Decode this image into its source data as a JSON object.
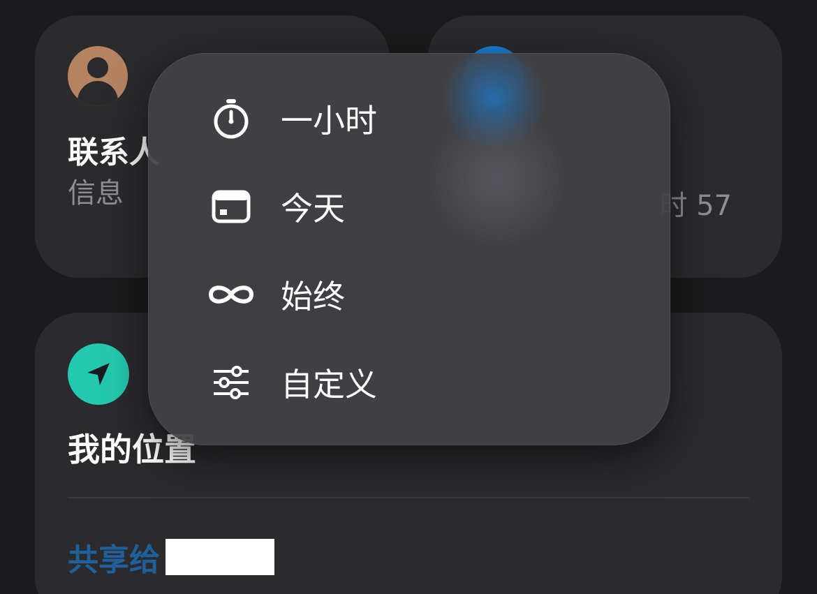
{
  "contact_card": {
    "title": "联系人",
    "subtitle": "信息",
    "avatar_color": "#b58360"
  },
  "other_card": {
    "time_text": "时 57",
    "dot_color": "#1a7fd6"
  },
  "location_card": {
    "title": "我的位置",
    "share_label": "共享给",
    "icon_color": "#25c9b0"
  },
  "menu": {
    "items": [
      {
        "icon": "stopwatch-icon",
        "label": "一小时"
      },
      {
        "icon": "calendar-day-icon",
        "label": "今天"
      },
      {
        "icon": "infinity-icon",
        "label": "始终"
      },
      {
        "icon": "sliders-icon",
        "label": "自定义"
      }
    ]
  }
}
